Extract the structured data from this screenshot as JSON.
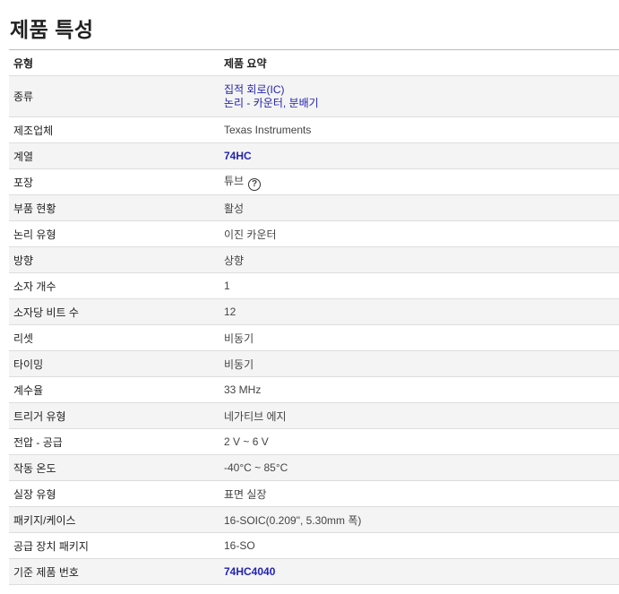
{
  "page": {
    "title": "제품 특성"
  },
  "table": {
    "header": {
      "name": "유형",
      "value": "제품 요약"
    },
    "rows": [
      {
        "name": "종류",
        "links": [
          "집적 회로(IC)",
          "논리 - 카운터, 분배기"
        ]
      },
      {
        "name": "제조업체",
        "value": "Texas Instruments"
      },
      {
        "name": "계열",
        "link": "74HC"
      },
      {
        "name": "포장",
        "value": "튜브",
        "help_icon": "question-circle-icon"
      },
      {
        "name": "부품 현황",
        "value": "활성"
      },
      {
        "name": "논리 유형",
        "value": "이진 카운터"
      },
      {
        "name": "방향",
        "value": "상향"
      },
      {
        "name": "소자 개수",
        "value": "1"
      },
      {
        "name": "소자당 비트 수",
        "value": "12"
      },
      {
        "name": "리셋",
        "value": "비동기"
      },
      {
        "name": "타이밍",
        "value": "비동기"
      },
      {
        "name": "계수율",
        "value": "33 MHz"
      },
      {
        "name": "트리거 유형",
        "value": "네가티브 에지"
      },
      {
        "name": "전압 - 공급",
        "value": "2 V ~ 6 V"
      },
      {
        "name": "작동 온도",
        "value": "-40°C ~ 85°C"
      },
      {
        "name": "실장 유형",
        "value": "표면 실장"
      },
      {
        "name": "패키지/케이스",
        "value": "16-SOIC(0.209\", 5.30mm 폭)"
      },
      {
        "name": "공급 장치 패키지",
        "value": "16-SO"
      },
      {
        "name": "기준 제품 번호",
        "link": "74HC4040"
      }
    ]
  },
  "colors": {
    "link": "#2323b3",
    "row_shade": "#f4f4f4",
    "border": "#dddddd"
  }
}
